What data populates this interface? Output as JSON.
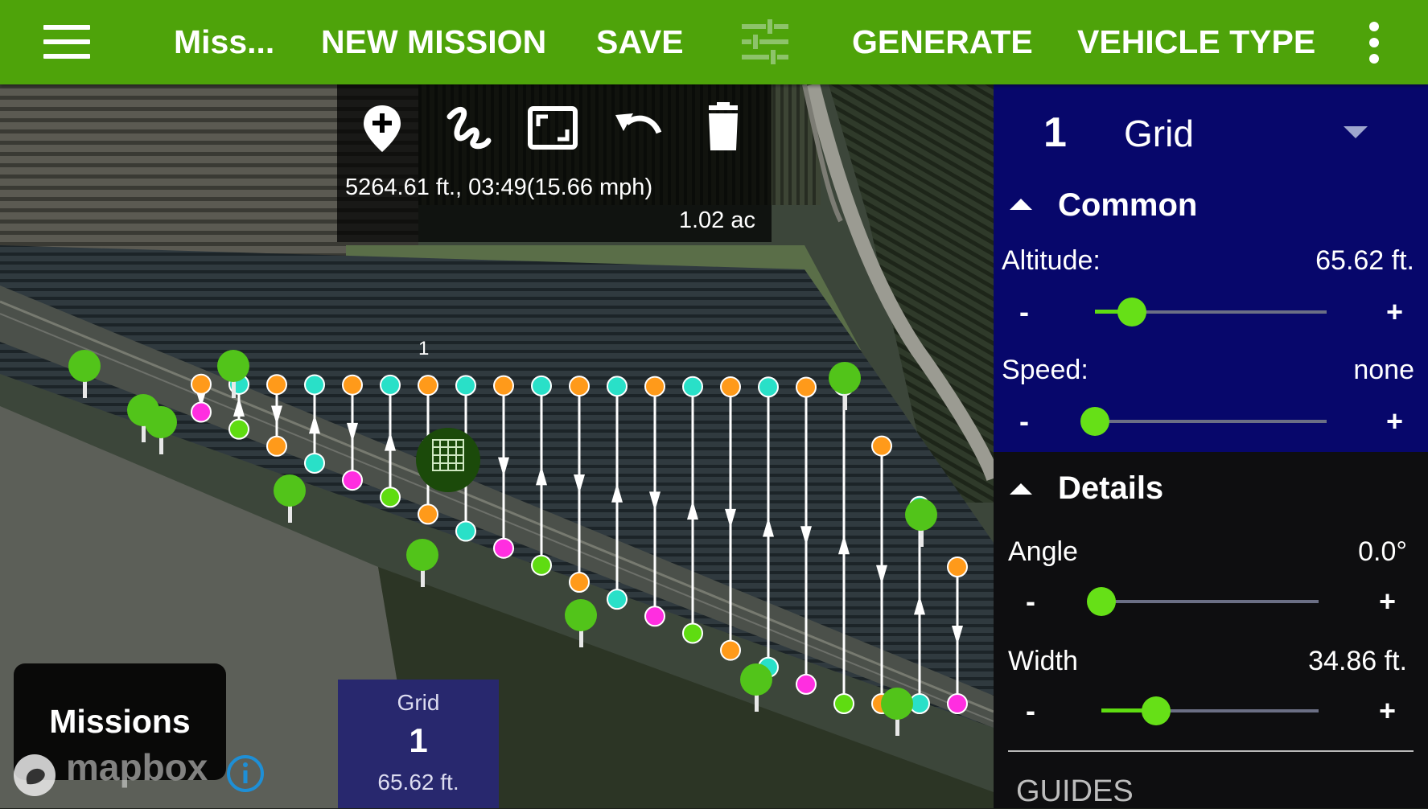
{
  "toolbar": {
    "menu_icon": "hamburger-menu-icon",
    "mission_name": "Miss...",
    "new_mission_label": "NEW MISSION",
    "save_label": "SAVE",
    "settings_icon": "tune-sliders-icon",
    "generate_label": "GENERATE",
    "vehicle_type_label": "VEHICLE TYPE",
    "overflow_icon": "more-vertical-icon",
    "color": "#4ea30a"
  },
  "map_tools": {
    "icons": [
      "add-marker-icon",
      "draw-freehand-icon",
      "fit-screen-icon",
      "undo-icon",
      "delete-icon"
    ],
    "stats": "5264.61 ft., 03:49(15.66 mph)",
    "area": "1.02 ac"
  },
  "map": {
    "grid_item_number": "1",
    "waypoint_colors": [
      "#ff9a1a",
      "#29e0c8",
      "#ff2ee0",
      "#5fdc11"
    ]
  },
  "item_panel": {
    "index": "1",
    "type": "Grid",
    "common": {
      "title": "Common",
      "altitude_label": "Altitude:",
      "altitude_value": "65.62 ft.",
      "altitude_slider": 0.16,
      "speed_label": "Speed:",
      "speed_value": "none",
      "speed_slider": 0.0,
      "minus": "-",
      "plus": "+"
    },
    "details": {
      "title": "Details",
      "angle_label": "Angle",
      "angle_value": "0.0°",
      "angle_slider": 0.0,
      "width_label": "Width",
      "width_value": "34.86 ft.",
      "width_slider": 0.25,
      "guides_label": "GUIDES"
    },
    "common_bg": "#07076b",
    "accent": "#66e017"
  },
  "missions_button": "Missions",
  "mapbox_wordmark": "mapbox",
  "mission_items": [
    {
      "type": "Grid",
      "number": "1",
      "altitude": "65.62 ft."
    }
  ]
}
